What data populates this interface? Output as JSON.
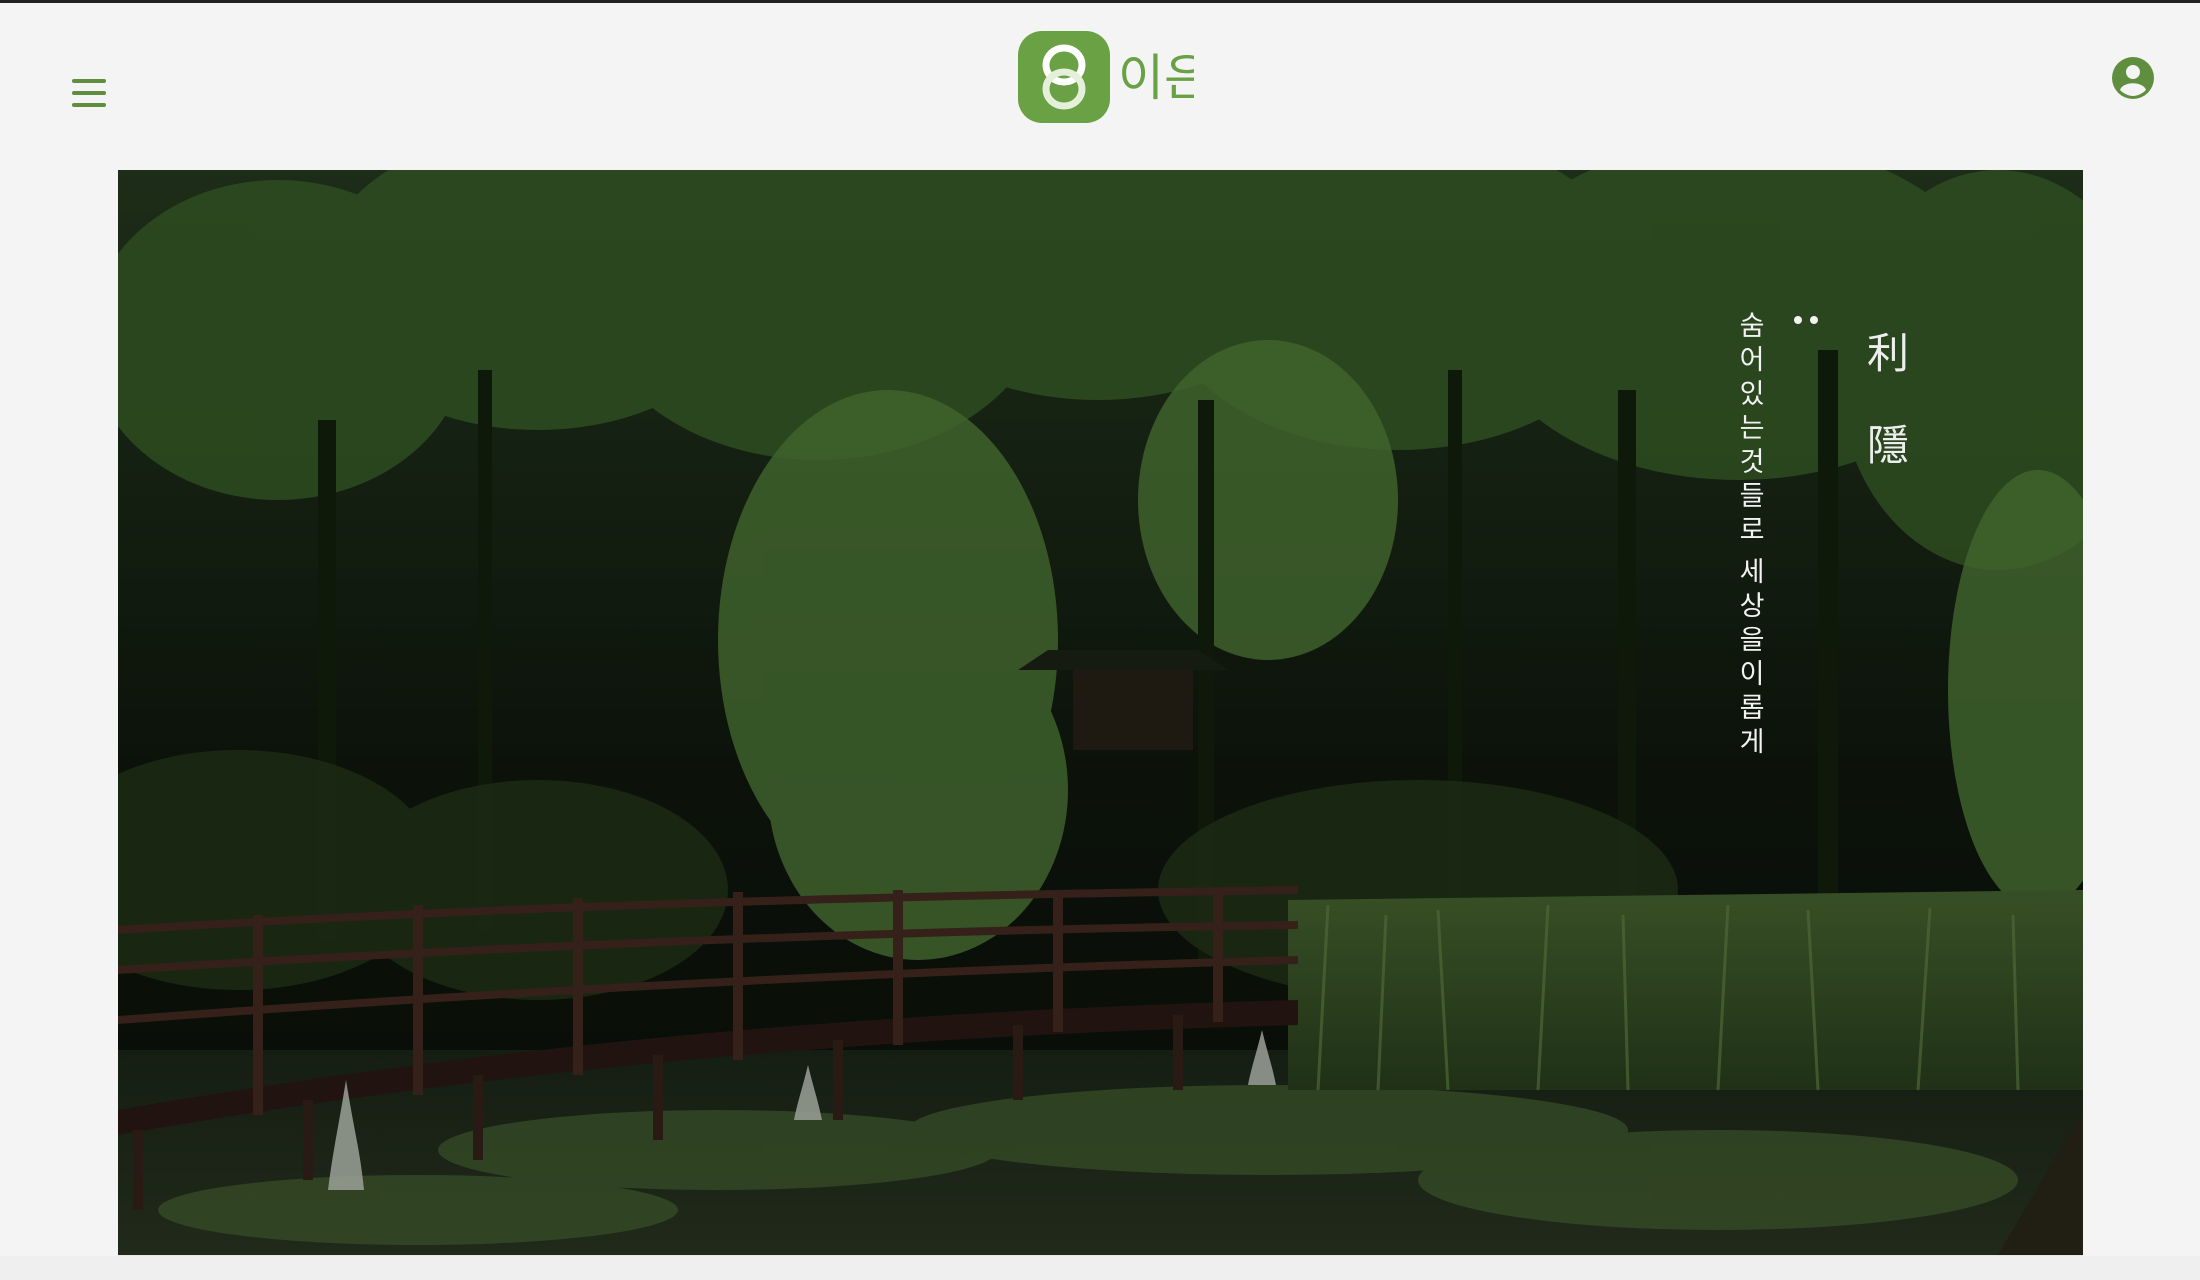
{
  "header": {
    "menu_icon": "hamburger-menu-icon",
    "logo_text": "이은",
    "user_icon": "user-account-icon"
  },
  "colors": {
    "brand_green": "#6aa144",
    "icon_green": "#5f8f3e",
    "background": "#f4f4f4"
  },
  "hero": {
    "tagline_line1": "숨어있는것들로",
    "tagline_line2": "세상을이롭게",
    "brand_char1": "利",
    "brand_char2": "隱"
  }
}
